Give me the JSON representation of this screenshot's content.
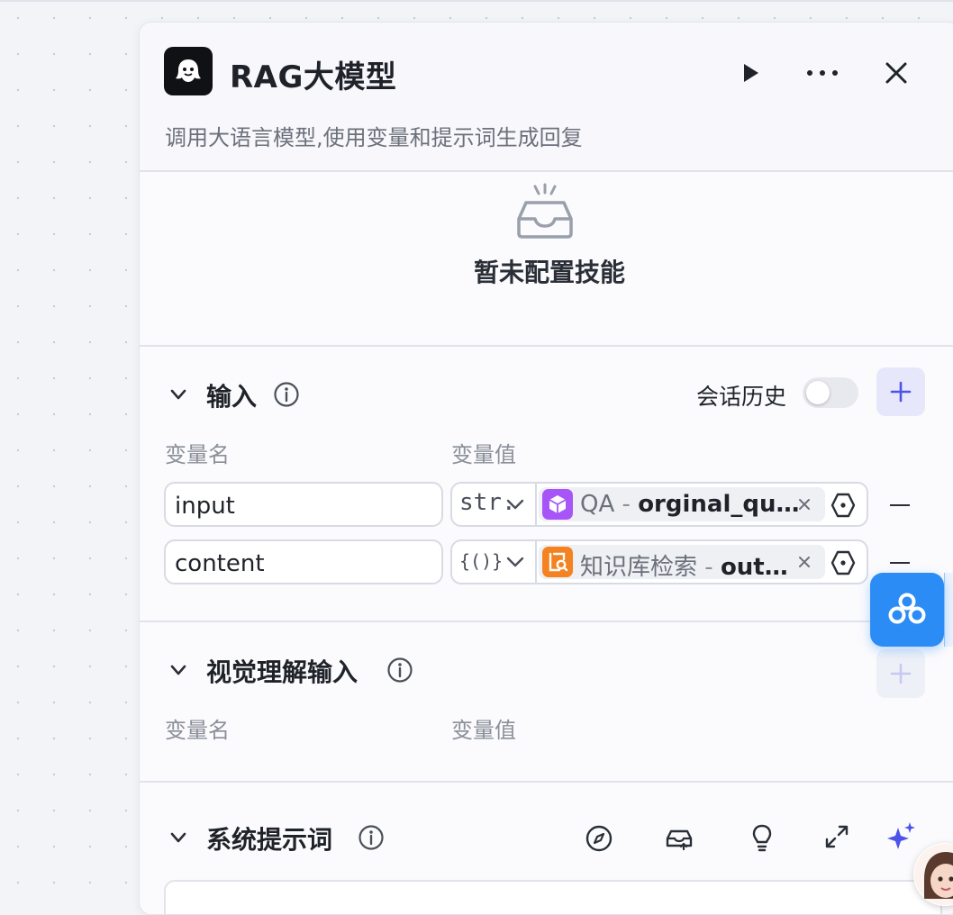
{
  "node": {
    "title": "RAG大模型",
    "description": "调用大语言模型,使用变量和提示词生成回复",
    "header_actions": [
      "play-icon",
      "more-icon",
      "close-icon"
    ]
  },
  "skills": {
    "empty_text": "暂未配置技能"
  },
  "input_section": {
    "title": "输入",
    "toggle_label": "会话历史",
    "toggle_on": false,
    "col_name": "变量名",
    "col_value": "变量值",
    "rows": [
      {
        "name": "input",
        "type": "str.",
        "source": "QA",
        "sep": "-",
        "field": "orginal_qu…"
      },
      {
        "name": "content",
        "type": "{()}",
        "source": "知识库检索",
        "sep": "-",
        "field": "out…"
      }
    ]
  },
  "vision_section": {
    "title": "视觉理解输入",
    "col_name": "变量名",
    "col_value": "变量值"
  },
  "system_prompt": {
    "title": "系统提示词",
    "tools": [
      "compass-icon",
      "library-icon",
      "lightbulb-icon",
      "expand-icon",
      "sparkle-icon"
    ]
  },
  "colors": {
    "accent": "#4d53e8",
    "add_button_bg": "#e6e7fb",
    "float_button": "#2b8cf5",
    "qa_tag_icon": "#a855f7",
    "kb_tag_icon": "#f58220"
  }
}
